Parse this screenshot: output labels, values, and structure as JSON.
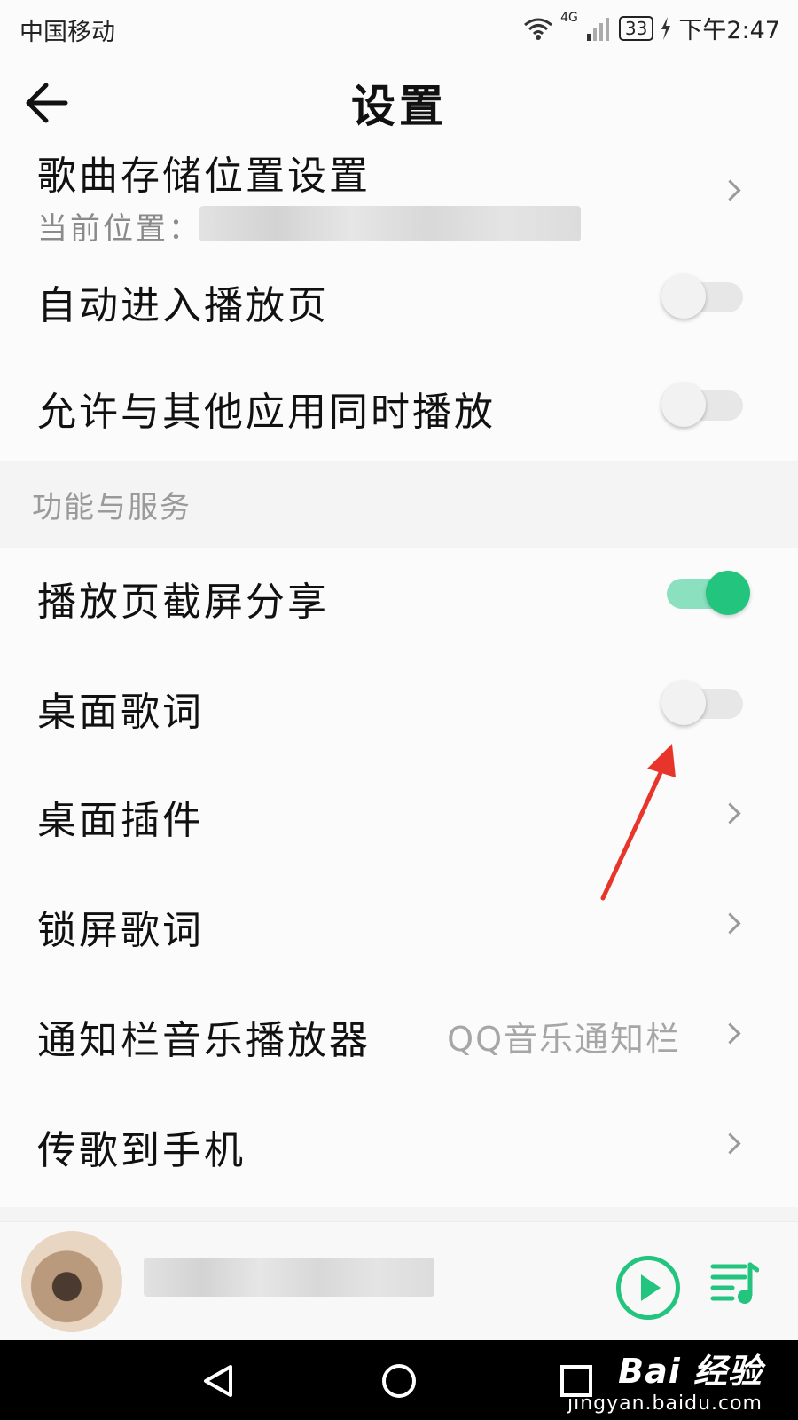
{
  "status_bar": {
    "carrier": "中国移动",
    "network": "4G",
    "battery": "33",
    "time": "下午2:47"
  },
  "header": {
    "title": "设置"
  },
  "settings": {
    "storage": {
      "label": "歌曲存储位置设置",
      "sublabel": "当前位置："
    },
    "auto_enter_player": {
      "label": "自动进入播放页",
      "enabled": false
    },
    "allow_simultaneous": {
      "label": "允许与其他应用同时播放",
      "enabled": false
    }
  },
  "features": {
    "section_title": "功能与服务",
    "items": [
      {
        "label": "播放页截屏分享",
        "control": "toggle",
        "enabled": true
      },
      {
        "label": "桌面歌词",
        "control": "toggle",
        "enabled": false
      },
      {
        "label": "桌面插件",
        "control": "chevron"
      },
      {
        "label": "锁屏歌词",
        "control": "chevron"
      },
      {
        "label": "通知栏音乐播放器",
        "control": "chevron",
        "value": "QQ音乐通知栏"
      },
      {
        "label": "传歌到手机",
        "control": "chevron"
      }
    ]
  },
  "watermark": {
    "brand": "Bai  经验",
    "sub": "jingyan.baidu.com"
  },
  "colors": {
    "accent": "#22c47e",
    "toggle_on_track": "#8be0bf",
    "toggle_off_track": "#e7e7e7",
    "annotation_arrow": "#e8352b"
  }
}
